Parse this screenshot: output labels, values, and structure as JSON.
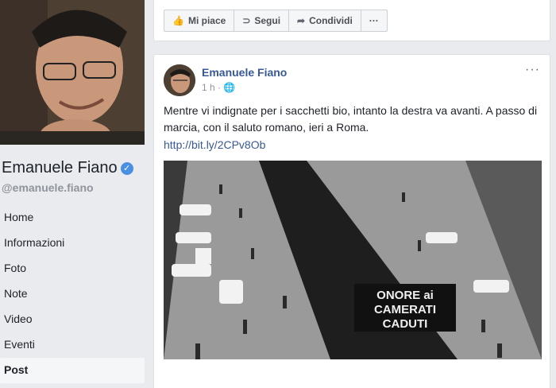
{
  "profile": {
    "name": "Emanuele Fiano",
    "handle": "@emanuele.fiano"
  },
  "nav": {
    "items": [
      {
        "label": "Home"
      },
      {
        "label": "Informazioni"
      },
      {
        "label": "Foto"
      },
      {
        "label": "Note"
      },
      {
        "label": "Video"
      },
      {
        "label": "Eventi"
      },
      {
        "label": "Post"
      }
    ],
    "active": "Post"
  },
  "actions": {
    "like_label": "Mi piace",
    "follow_label": "Segui",
    "share_label": "Condividi",
    "more_label": "···"
  },
  "post": {
    "author": "Emanuele Fiano",
    "time": "1 h",
    "text": "Mentre vi indignate per i sacchetti bio, intanto la destra va avanti. A passo di marcia, con il saluto romano, ieri a Roma.",
    "link": "http://bit.ly/2CPv8Ob",
    "menu": "···",
    "banner_lines": [
      "ONORE ai",
      "CAMERATI",
      "CADUTI"
    ]
  },
  "colors": {
    "background": "#e9ebee",
    "link": "#385898",
    "verified": "#4a90e2"
  }
}
